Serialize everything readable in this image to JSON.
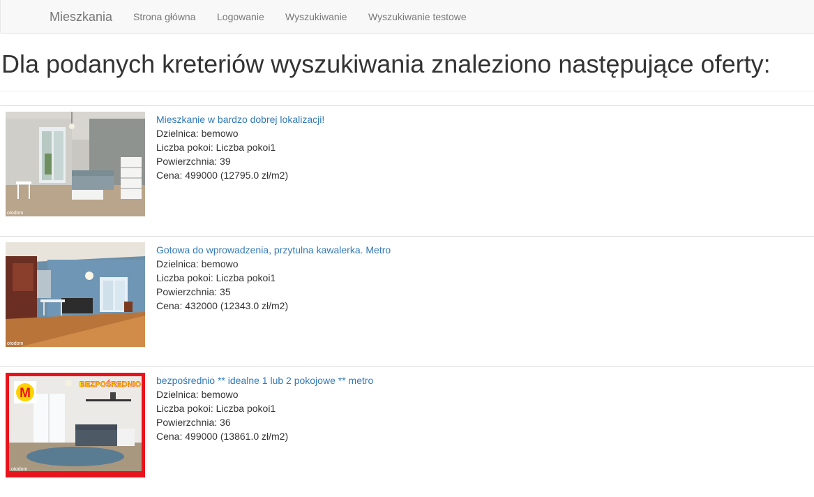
{
  "navbar": {
    "brand": "Mieszkania",
    "links": [
      "Strona główna",
      "Logowanie",
      "Wyszukiwanie",
      "Wyszukiwanie testowe"
    ]
  },
  "page": {
    "title": "Dla podanych kreteriów wyszukiwania znaleziono następujące oferty:"
  },
  "offers": [
    {
      "title": "Mieszkanie w bardzo dobrej lokalizacji!",
      "district": "Dzielnica: bemowo",
      "rooms": "Liczba pokoi: Liczba pokoi1",
      "area": "Powierzchnia: 39",
      "price": "Cena: 499000 (12795.0 zł/m2)",
      "watermark": "otodom"
    },
    {
      "title": "Gotowa do wprowadzenia, przytulna kawalerka. Metro",
      "district": "Dzielnica: bemowo",
      "rooms": "Liczba pokoi: Liczba pokoi1",
      "area": "Powierzchnia: 35",
      "price": "Cena: 432000 (12343.0 zł/m2)",
      "watermark": "otodom"
    },
    {
      "title": "bezpośrednio ** idealne 1 lub 2 pokojowe ** metro",
      "district": "Dzielnica: bemowo",
      "rooms": "Liczba pokoi: Liczba pokoi1",
      "area": "Powierzchnia: 36",
      "price": "Cena: 499000 (13861.0 zł/m2)",
      "watermark": "otodom",
      "badge_text": "BEZPOŚREDNIO",
      "badge_logo": "M"
    }
  ],
  "colors": {
    "link": "#337ab7",
    "navbar_bg": "#f8f8f8",
    "nav_text": "#777777",
    "badge_red": "#e8141c"
  }
}
